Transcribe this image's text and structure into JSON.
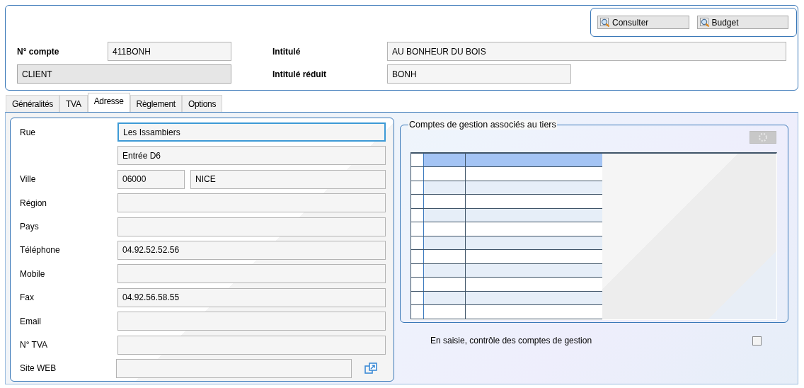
{
  "header": {
    "buttons": [
      {
        "label": "Consulter"
      },
      {
        "label": "Budget"
      }
    ],
    "account_number": {
      "label": "N° compte",
      "value": "411BONH"
    },
    "category": {
      "value": "CLIENT"
    },
    "title": {
      "label": "Intitulé",
      "value": "AU BONHEUR DU BOIS"
    },
    "short_title": {
      "label": "Intitulé réduit",
      "value": "BONH"
    }
  },
  "tabs": [
    {
      "label": "Généralités",
      "selected": false
    },
    {
      "label": "TVA",
      "selected": false
    },
    {
      "label": "Adresse",
      "selected": true
    },
    {
      "label": "Règlement",
      "selected": false
    },
    {
      "label": "Options",
      "selected": false
    }
  ],
  "address": {
    "rows": [
      {
        "kind": "text",
        "label": "Rue",
        "fields": [
          {
            "value": "Les Issambiers",
            "focused": true
          }
        ]
      },
      {
        "kind": "text",
        "fields": [
          {
            "value": "Entrée D6",
            "focused": false
          }
        ]
      },
      {
        "kind": "text",
        "label": "Ville",
        "fields": [
          {
            "value": "06000",
            "focused": false
          },
          {
            "value": "NICE",
            "focused": false
          }
        ]
      },
      {
        "kind": "text",
        "label": "Région",
        "fields": [
          {
            "focused": false
          }
        ]
      },
      {
        "kind": "text",
        "label": "Pays",
        "fields": [
          {
            "focused": false
          }
        ]
      },
      {
        "kind": "text",
        "label": "Téléphone",
        "fields": [
          {
            "value": "04.92.52.52.56",
            "focused": false
          }
        ]
      },
      {
        "kind": "text",
        "label": "Mobile",
        "fields": [
          {
            "focused": false
          }
        ]
      },
      {
        "kind": "text",
        "label": "Fax",
        "fields": [
          {
            "value": "04.92.56.58.55",
            "focused": false
          }
        ]
      },
      {
        "kind": "text",
        "label": "Email",
        "fields": [
          {
            "focused": false
          }
        ]
      },
      {
        "kind": "text",
        "label": "N° TVA",
        "fields": [
          {
            "focused": false
          }
        ]
      },
      {
        "kind": "link",
        "label": "Site WEB",
        "fields": [
          {
            "focused": false
          }
        ]
      }
    ]
  },
  "management_accounts": {
    "legend": "Comptes de gestion associés au tiers"
  },
  "check_option": {
    "label": "En saisie, contrôle des comptes de gestion",
    "checked": false
  }
}
